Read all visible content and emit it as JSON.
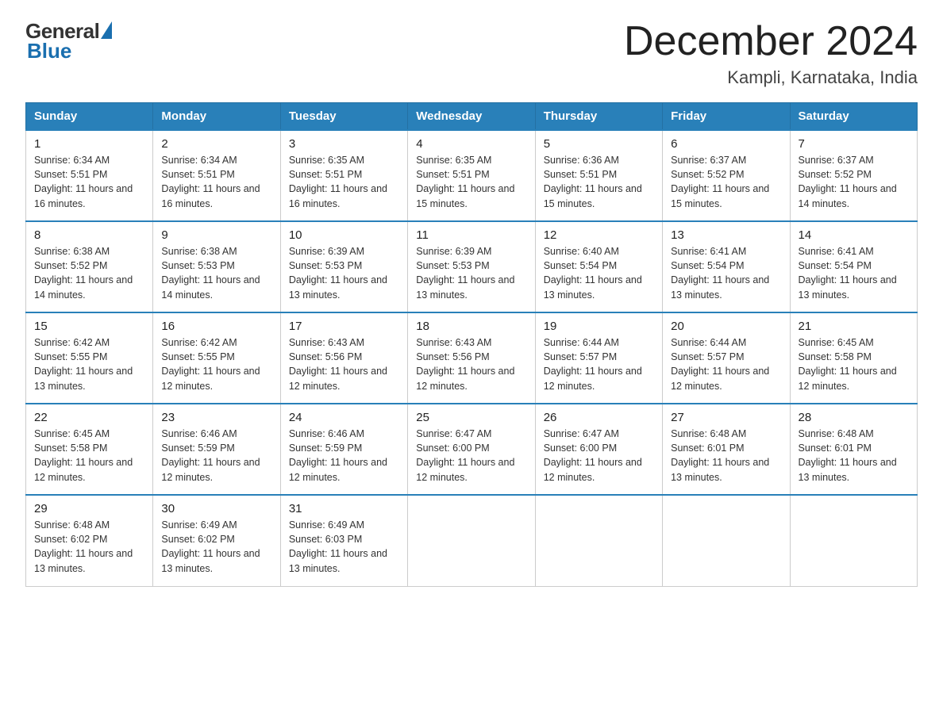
{
  "header": {
    "logo_general": "General",
    "logo_blue": "Blue",
    "month_title": "December 2024",
    "location": "Kampli, Karnataka, India"
  },
  "days_of_week": [
    "Sunday",
    "Monday",
    "Tuesday",
    "Wednesday",
    "Thursday",
    "Friday",
    "Saturday"
  ],
  "weeks": [
    [
      {
        "day": "1",
        "sunrise": "6:34 AM",
        "sunset": "5:51 PM",
        "daylight": "11 hours and 16 minutes."
      },
      {
        "day": "2",
        "sunrise": "6:34 AM",
        "sunset": "5:51 PM",
        "daylight": "11 hours and 16 minutes."
      },
      {
        "day": "3",
        "sunrise": "6:35 AM",
        "sunset": "5:51 PM",
        "daylight": "11 hours and 16 minutes."
      },
      {
        "day": "4",
        "sunrise": "6:35 AM",
        "sunset": "5:51 PM",
        "daylight": "11 hours and 15 minutes."
      },
      {
        "day": "5",
        "sunrise": "6:36 AM",
        "sunset": "5:51 PM",
        "daylight": "11 hours and 15 minutes."
      },
      {
        "day": "6",
        "sunrise": "6:37 AM",
        "sunset": "5:52 PM",
        "daylight": "11 hours and 15 minutes."
      },
      {
        "day": "7",
        "sunrise": "6:37 AM",
        "sunset": "5:52 PM",
        "daylight": "11 hours and 14 minutes."
      }
    ],
    [
      {
        "day": "8",
        "sunrise": "6:38 AM",
        "sunset": "5:52 PM",
        "daylight": "11 hours and 14 minutes."
      },
      {
        "day": "9",
        "sunrise": "6:38 AM",
        "sunset": "5:53 PM",
        "daylight": "11 hours and 14 minutes."
      },
      {
        "day": "10",
        "sunrise": "6:39 AM",
        "sunset": "5:53 PM",
        "daylight": "11 hours and 13 minutes."
      },
      {
        "day": "11",
        "sunrise": "6:39 AM",
        "sunset": "5:53 PM",
        "daylight": "11 hours and 13 minutes."
      },
      {
        "day": "12",
        "sunrise": "6:40 AM",
        "sunset": "5:54 PM",
        "daylight": "11 hours and 13 minutes."
      },
      {
        "day": "13",
        "sunrise": "6:41 AM",
        "sunset": "5:54 PM",
        "daylight": "11 hours and 13 minutes."
      },
      {
        "day": "14",
        "sunrise": "6:41 AM",
        "sunset": "5:54 PM",
        "daylight": "11 hours and 13 minutes."
      }
    ],
    [
      {
        "day": "15",
        "sunrise": "6:42 AM",
        "sunset": "5:55 PM",
        "daylight": "11 hours and 13 minutes."
      },
      {
        "day": "16",
        "sunrise": "6:42 AM",
        "sunset": "5:55 PM",
        "daylight": "11 hours and 12 minutes."
      },
      {
        "day": "17",
        "sunrise": "6:43 AM",
        "sunset": "5:56 PM",
        "daylight": "11 hours and 12 minutes."
      },
      {
        "day": "18",
        "sunrise": "6:43 AM",
        "sunset": "5:56 PM",
        "daylight": "11 hours and 12 minutes."
      },
      {
        "day": "19",
        "sunrise": "6:44 AM",
        "sunset": "5:57 PM",
        "daylight": "11 hours and 12 minutes."
      },
      {
        "day": "20",
        "sunrise": "6:44 AM",
        "sunset": "5:57 PM",
        "daylight": "11 hours and 12 minutes."
      },
      {
        "day": "21",
        "sunrise": "6:45 AM",
        "sunset": "5:58 PM",
        "daylight": "11 hours and 12 minutes."
      }
    ],
    [
      {
        "day": "22",
        "sunrise": "6:45 AM",
        "sunset": "5:58 PM",
        "daylight": "11 hours and 12 minutes."
      },
      {
        "day": "23",
        "sunrise": "6:46 AM",
        "sunset": "5:59 PM",
        "daylight": "11 hours and 12 minutes."
      },
      {
        "day": "24",
        "sunrise": "6:46 AM",
        "sunset": "5:59 PM",
        "daylight": "11 hours and 12 minutes."
      },
      {
        "day": "25",
        "sunrise": "6:47 AM",
        "sunset": "6:00 PM",
        "daylight": "11 hours and 12 minutes."
      },
      {
        "day": "26",
        "sunrise": "6:47 AM",
        "sunset": "6:00 PM",
        "daylight": "11 hours and 12 minutes."
      },
      {
        "day": "27",
        "sunrise": "6:48 AM",
        "sunset": "6:01 PM",
        "daylight": "11 hours and 13 minutes."
      },
      {
        "day": "28",
        "sunrise": "6:48 AM",
        "sunset": "6:01 PM",
        "daylight": "11 hours and 13 minutes."
      }
    ],
    [
      {
        "day": "29",
        "sunrise": "6:48 AM",
        "sunset": "6:02 PM",
        "daylight": "11 hours and 13 minutes."
      },
      {
        "day": "30",
        "sunrise": "6:49 AM",
        "sunset": "6:02 PM",
        "daylight": "11 hours and 13 minutes."
      },
      {
        "day": "31",
        "sunrise": "6:49 AM",
        "sunset": "6:03 PM",
        "daylight": "11 hours and 13 minutes."
      },
      null,
      null,
      null,
      null
    ]
  ]
}
